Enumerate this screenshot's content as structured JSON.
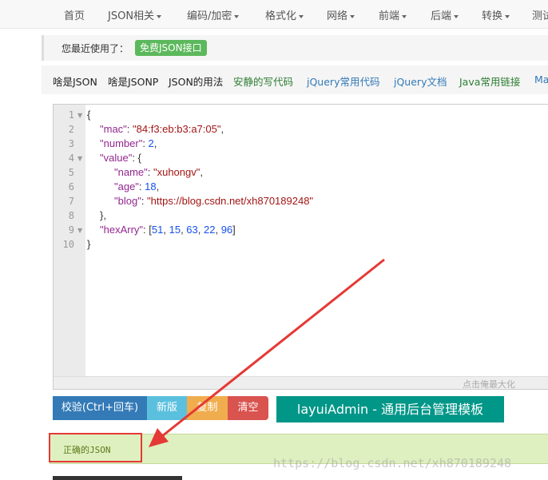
{
  "nav": {
    "items": [
      {
        "label": "首页",
        "dropdown": false
      },
      {
        "label": "JSON相关",
        "dropdown": true
      },
      {
        "label": "编码/加密",
        "dropdown": true
      },
      {
        "label": "格式化",
        "dropdown": true
      },
      {
        "label": "网络",
        "dropdown": true
      },
      {
        "label": "前端",
        "dropdown": true
      },
      {
        "label": "后端",
        "dropdown": true
      },
      {
        "label": "转换",
        "dropdown": true
      },
      {
        "label": "测试",
        "dropdown": false
      }
    ]
  },
  "recent": {
    "label": "您最近使用了：",
    "tag": "免费JSON接口"
  },
  "links": [
    {
      "label": "啥是JSON",
      "color": "#222222"
    },
    {
      "label": "啥是JSONP",
      "color": "#222222"
    },
    {
      "label": "JSON的用法",
      "color": "#222222"
    },
    {
      "label": "安静的写代码",
      "color": "#2e7d32"
    },
    {
      "label": "jQuery常用代码",
      "color": "#337ab7"
    },
    {
      "label": "jQuery文档",
      "color": "#337ab7"
    },
    {
      "label": "Java常用链接",
      "color": "#2e7d32"
    },
    {
      "label": "Ma",
      "color": "#337ab7"
    }
  ],
  "editor": {
    "line_numbers": [
      "1",
      "2",
      "3",
      "4",
      "5",
      "6",
      "7",
      "8",
      "9",
      "10"
    ],
    "code": {
      "l1_open": "{",
      "l2_key": "\"mac\"",
      "l2_val": "\"84:f3:eb:b3:a7:05\"",
      "l3_key": "\"number\"",
      "l3_val": "2",
      "l4_key": "\"value\"",
      "l4_open": "{",
      "l5_key": "\"name\"",
      "l5_val": "\"xuhongv\"",
      "l6_key": "\"age\"",
      "l6_val": "18",
      "l7_key": "\"blog\"",
      "l7_val": "\"https://blog.csdn.net/xh870189248\"",
      "l8_close": "},",
      "l9_key": "\"hexArry\"",
      "l9_open": "[",
      "l9_vals": [
        "51",
        "15",
        "63",
        "22",
        "96"
      ],
      "l9_close": "]",
      "l10_close": "}"
    },
    "status_text": "点击俺最大化"
  },
  "buttons": {
    "check": "校验(Ctrl+回车)",
    "new": "新版",
    "copy": "复制",
    "clear": "清空",
    "ad": "layuiAdmin - 通用后台管理模板"
  },
  "result": {
    "text": "正确的JSON",
    "watermark": "https://blog.csdn.net/xh870189248"
  },
  "colors": {
    "annotation": "#e53935",
    "result_bg": "#dff0c0",
    "ad_button": "#009688"
  }
}
